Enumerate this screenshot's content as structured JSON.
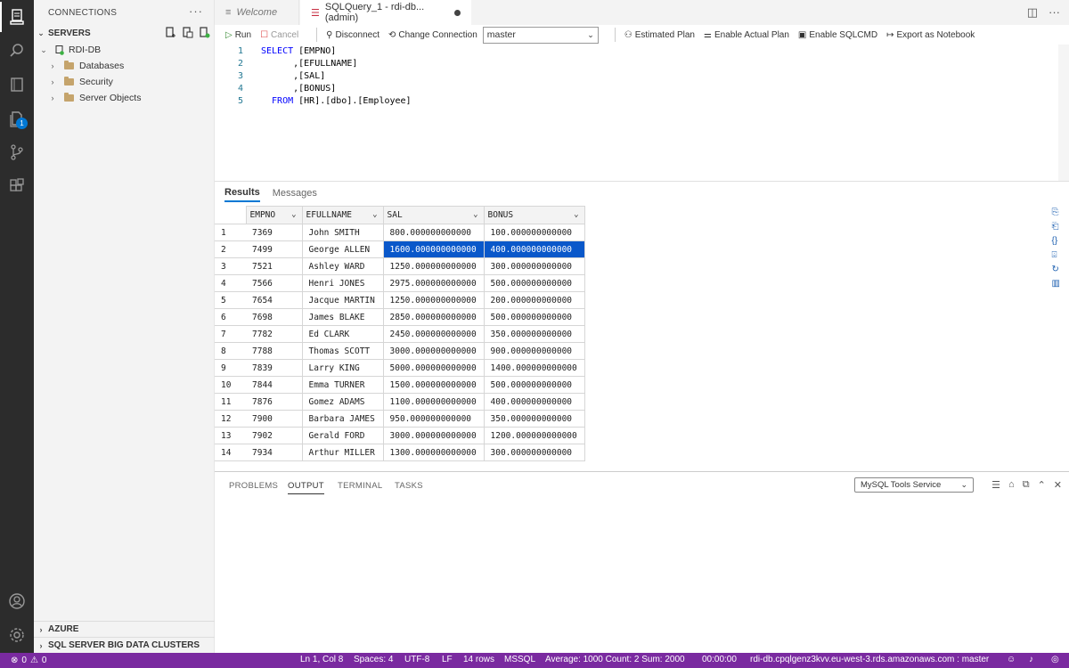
{
  "sidebar": {
    "title": "CONNECTIONS",
    "servers_label": "SERVERS",
    "server_name": "RDI-DB",
    "tree": [
      "Databases",
      "Security",
      "Server Objects"
    ],
    "azure_label": "AZURE",
    "bdc_label": "SQL SERVER BIG DATA CLUSTERS"
  },
  "activity": {
    "badge_count": "1"
  },
  "tabs": {
    "welcome": "Welcome",
    "query": "SQLQuery_1 - rdi-db...(admin)"
  },
  "toolbar": {
    "run": "Run",
    "cancel": "Cancel",
    "disconnect": "Disconnect",
    "change_connection": "Change Connection",
    "database": "master",
    "estimated_plan": "Estimated Plan",
    "actual_plan": "Enable Actual Plan",
    "sqlcmd": "Enable SQLCMD",
    "export": "Export as Notebook"
  },
  "editor": {
    "lines": [
      {
        "num": "1",
        "kw": "SELECT",
        "rest": " [EMPNO]"
      },
      {
        "num": "2",
        "kw": "",
        "rest": "      ,[EFULLNAME]"
      },
      {
        "num": "3",
        "kw": "",
        "rest": "      ,[SAL]"
      },
      {
        "num": "4",
        "kw": "",
        "rest": "      ,[BONUS]"
      },
      {
        "num": "5",
        "kw": "  FROM",
        "rest": " [HR].[dbo].[Employee]"
      }
    ]
  },
  "results": {
    "tab_results": "Results",
    "tab_messages": "Messages",
    "columns": [
      "EMPNO",
      "EFULLNAME",
      "SAL",
      "BONUS"
    ],
    "rows": [
      [
        "1",
        "7369",
        "John SMITH",
        "800.000000000000",
        "100.000000000000"
      ],
      [
        "2",
        "7499",
        "George ALLEN",
        "1600.000000000000",
        "400.000000000000"
      ],
      [
        "3",
        "7521",
        "Ashley WARD",
        "1250.000000000000",
        "300.000000000000"
      ],
      [
        "4",
        "7566",
        "Henri JONES",
        "2975.000000000000",
        "500.000000000000"
      ],
      [
        "5",
        "7654",
        "Jacque MARTIN",
        "1250.000000000000",
        "200.000000000000"
      ],
      [
        "6",
        "7698",
        "James BLAKE",
        "2850.000000000000",
        "500.000000000000"
      ],
      [
        "7",
        "7782",
        "Ed CLARK",
        "2450.000000000000",
        "350.000000000000"
      ],
      [
        "8",
        "7788",
        "Thomas SCOTT",
        "3000.000000000000",
        "900.000000000000"
      ],
      [
        "9",
        "7839",
        "Larry KING",
        "5000.000000000000",
        "1400.000000000000"
      ],
      [
        "10",
        "7844",
        "Emma TURNER",
        "1500.000000000000",
        "500.000000000000"
      ],
      [
        "11",
        "7876",
        "Gomez ADAMS",
        "1100.000000000000",
        "400.000000000000"
      ],
      [
        "12",
        "7900",
        "Barbara JAMES",
        "950.000000000000",
        "350.000000000000"
      ],
      [
        "13",
        "7902",
        "Gerald FORD",
        "3000.000000000000",
        "1200.000000000000"
      ],
      [
        "14",
        "7934",
        "Arthur MILLER",
        "1300.000000000000",
        "300.000000000000"
      ]
    ],
    "selected_row": 1
  },
  "panel": {
    "tabs": [
      "PROBLEMS",
      "OUTPUT",
      "TERMINAL",
      "TASKS"
    ],
    "active_tab": "OUTPUT",
    "output_source": "MySQL Tools Service"
  },
  "status": {
    "errors": "0",
    "warnings": "0",
    "position": "Ln 1, Col 8",
    "spaces": "Spaces: 4",
    "encoding": "UTF-8",
    "eol": "LF",
    "rows": "14 rows",
    "language": "MSSQL",
    "summary": "Average: 1000  Count: 2  Sum: 2000",
    "time": "00:00:00",
    "connection": "rdi-db.cpqlgenz3kvv.eu-west-3.rds.amazonaws.com : master"
  },
  "colors": {
    "accent": "#0078d4",
    "statusbar": "#7a2aa0",
    "selection": "#0a58ca",
    "activitybar": "#2c2c2c"
  }
}
